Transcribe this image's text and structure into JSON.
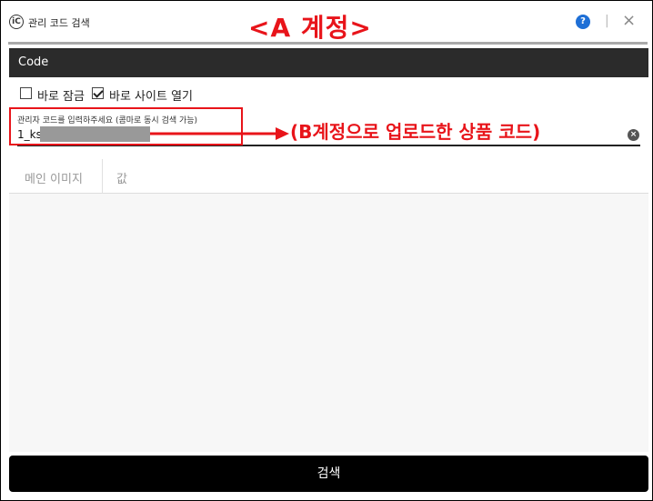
{
  "window": {
    "app_icon_glyph": "iC",
    "title": "관리 코드 검색",
    "annotation_title": "<A 계정>",
    "help_glyph": "?",
    "divider_glyph": "|",
    "close_glyph": "×"
  },
  "code_section": {
    "label": "Code"
  },
  "options": {
    "lock_label": "바로 잠금",
    "lock_checked": false,
    "open_site_label": "바로 사이트 열기",
    "open_site_checked": true
  },
  "search_field": {
    "label": "관리자 코드를 입력하주세요 (콤마로 동시 검색 가능)",
    "value": "1_ks",
    "clear_glyph": "×"
  },
  "annotation_arrow_text": "(B계정으로 업로드한 상품 코드)",
  "table": {
    "columns": [
      "메인 이미지",
      "값"
    ]
  },
  "search_button": {
    "label": "검색"
  },
  "colors": {
    "annotation": "#e8141a",
    "header_bar": "#2b2b2b",
    "help_icon": "#1e6fd6",
    "button": "#000000"
  }
}
